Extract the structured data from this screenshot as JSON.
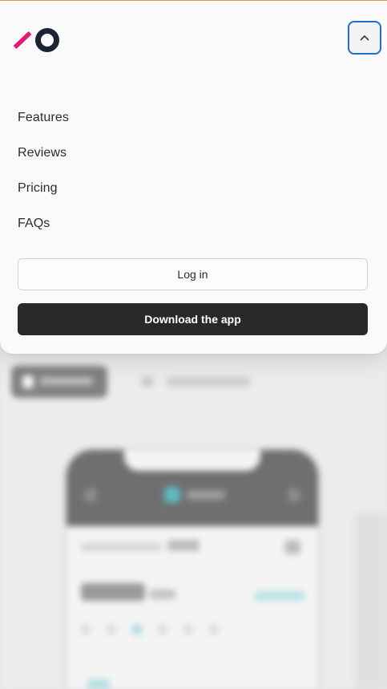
{
  "header": {
    "logo_icon": "brand-logo-icon",
    "collapse_icon": "chevron-up-icon"
  },
  "nav": {
    "items": [
      {
        "label": "Features"
      },
      {
        "label": "Reviews"
      },
      {
        "label": "Pricing"
      },
      {
        "label": "FAQs"
      }
    ]
  },
  "actions": {
    "login_label": "Log in",
    "download_label": "Download the app"
  },
  "colors": {
    "brand_pink": "#e6197a",
    "brand_navy": "#1c2434",
    "focus_ring": "#1f6fd1",
    "primary_button": "#292929",
    "background_accent": "#5fb9c4"
  }
}
